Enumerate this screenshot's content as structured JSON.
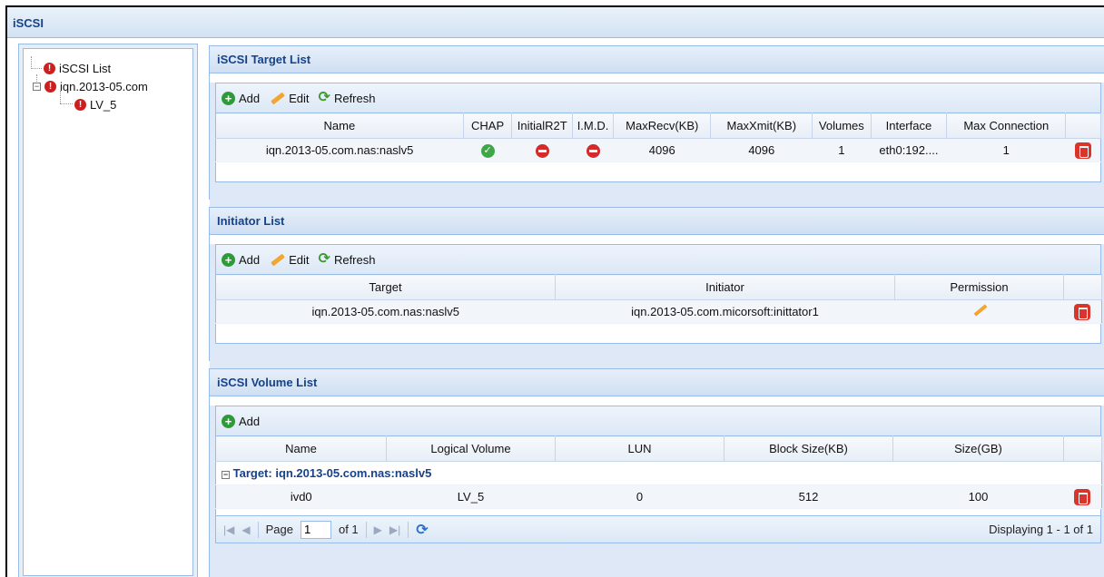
{
  "app": {
    "title": "iSCSI"
  },
  "tree": {
    "root": "iSCSI List",
    "target": "iqn.2013-05.com",
    "lv": "LV_5"
  },
  "target_panel": {
    "title": "iSCSI Target List",
    "toolbar": {
      "add": "Add",
      "edit": "Edit",
      "refresh": "Refresh"
    },
    "columns": [
      "Name",
      "CHAP",
      "InitialR2T",
      "I.M.D.",
      "MaxRecv(KB)",
      "MaxXmit(KB)",
      "Volumes",
      "Interface",
      "Max Connection"
    ],
    "rows": [
      {
        "name": "iqn.2013-05.com.nas:naslv5",
        "chap": "enabled",
        "initialr2t": "disabled",
        "imd": "disabled",
        "maxrecv": "4096",
        "maxxmit": "4096",
        "volumes": "1",
        "interface": "eth0:192....",
        "maxconn": "1"
      }
    ]
  },
  "initiator_panel": {
    "title": "Initiator List",
    "toolbar": {
      "add": "Add",
      "edit": "Edit",
      "refresh": "Refresh"
    },
    "columns": [
      "Target",
      "Initiator",
      "Permission"
    ],
    "rows": [
      {
        "target": "iqn.2013-05.com.nas:naslv5",
        "initiator": "iqn.2013-05.com.micorsoft:inittator1"
      }
    ]
  },
  "volume_panel": {
    "title": "iSCSI Volume List",
    "toolbar": {
      "add": "Add"
    },
    "columns": [
      "Name",
      "Logical Volume",
      "LUN",
      "Block Size(KB)",
      "Size(GB)"
    ],
    "group": "Target: iqn.2013-05.com.nas:naslv5",
    "rows": [
      {
        "name": "ivd0",
        "lv": "LV_5",
        "lun": "0",
        "block": "512",
        "size": "100"
      }
    ],
    "pager": {
      "page_label": "Page",
      "page_value": "1",
      "of_label": "of 1",
      "display": "Displaying 1 - 1 of 1"
    }
  },
  "colors": {
    "header_text": "#15428b",
    "border": "#99bbe8",
    "add": "#2f9a3a",
    "delete": "#d8362c"
  },
  "icons": {
    "target": "iscsi-target-icon",
    "add": "add-icon",
    "edit": "edit-pencil-icon",
    "refresh": "refresh-icon",
    "chap_ok": "check-circle-icon",
    "disabled": "no-entry-icon",
    "delete": "trash-icon"
  }
}
